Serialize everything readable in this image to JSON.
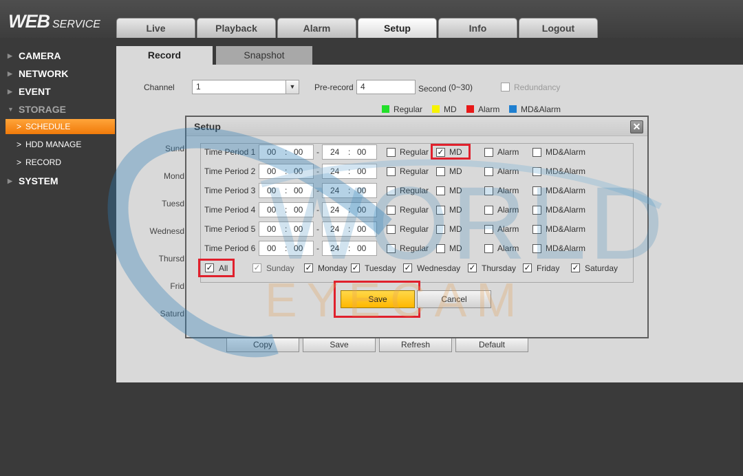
{
  "app": {
    "logo_main": "WEB",
    "logo_sub": "SERVICE"
  },
  "top_tabs": [
    "Live",
    "Playback",
    "Alarm",
    "Setup",
    "Info",
    "Logout"
  ],
  "sidebar": {
    "sections": [
      "CAMERA",
      "NETWORK",
      "EVENT",
      "STORAGE",
      "SYSTEM"
    ],
    "storage_items": [
      "SCHEDULE",
      "HDD MANAGE",
      "RECORD"
    ]
  },
  "sub_tabs": [
    "Record",
    "Snapshot"
  ],
  "record_form": {
    "channel_label": "Channel",
    "channel_value": "1",
    "prerecord_label": "Pre-record",
    "prerecord_value": "4",
    "prerecord_unit": "Second",
    "prerecord_range": "(0~30)",
    "redundancy_label": "Redundancy",
    "legend": [
      {
        "label": "Regular",
        "color": "#22e02a"
      },
      {
        "label": "MD",
        "color": "#f7f300"
      },
      {
        "label": "Alarm",
        "color": "#e81818"
      },
      {
        "label": "MD&Alarm",
        "color": "#1e7fd0"
      }
    ],
    "day_labels": [
      "Sund",
      "Mond",
      "Tuesd",
      "Wednesd",
      "Thursd",
      "Frid",
      "Saturd"
    ],
    "bottom_buttons": [
      "Copy",
      "Save",
      "Refresh",
      "Default"
    ]
  },
  "dialog": {
    "title": "Setup",
    "close_glyph": "✕",
    "periods": [
      {
        "label": "Time Period 1",
        "start_h": "00",
        "start_m": "00",
        "end_h": "24",
        "end_m": "00",
        "regular": false,
        "md": true,
        "alarm": false,
        "md_alarm": false
      },
      {
        "label": "Time Period 2",
        "start_h": "00",
        "start_m": "00",
        "end_h": "24",
        "end_m": "00",
        "regular": false,
        "md": false,
        "alarm": false,
        "md_alarm": false
      },
      {
        "label": "Time Period 3",
        "start_h": "00",
        "start_m": "00",
        "end_h": "24",
        "end_m": "00",
        "regular": false,
        "md": false,
        "alarm": false,
        "md_alarm": false
      },
      {
        "label": "Time Period 4",
        "start_h": "00",
        "start_m": "00",
        "end_h": "24",
        "end_m": "00",
        "regular": false,
        "md": false,
        "alarm": false,
        "md_alarm": false
      },
      {
        "label": "Time Period 5",
        "start_h": "00",
        "start_m": "00",
        "end_h": "24",
        "end_m": "00",
        "regular": false,
        "md": false,
        "alarm": false,
        "md_alarm": false
      },
      {
        "label": "Time Period 6",
        "start_h": "00",
        "start_m": "00",
        "end_h": "24",
        "end_m": "00",
        "regular": false,
        "md": false,
        "alarm": false,
        "md_alarm": false
      }
    ],
    "type_labels": [
      "Regular",
      "MD",
      "Alarm",
      "MD&Alarm"
    ],
    "time_sep": ":",
    "range_sep": "-",
    "all_label": "All",
    "all_checked": true,
    "days": [
      {
        "label": "Sunday",
        "checked": true,
        "disabled": true
      },
      {
        "label": "Monday",
        "checked": true,
        "disabled": false
      },
      {
        "label": "Tuesday",
        "checked": true,
        "disabled": false
      },
      {
        "label": "Wednesday",
        "checked": true,
        "disabled": false
      },
      {
        "label": "Thursday",
        "checked": true,
        "disabled": false
      },
      {
        "label": "Friday",
        "checked": true,
        "disabled": false
      },
      {
        "label": "Saturday",
        "checked": true,
        "disabled": false
      }
    ],
    "save_label": "Save",
    "cancel_label": "Cancel"
  },
  "watermark": {
    "line1": "WORLD",
    "line2": "EYECAM"
  },
  "colors": {
    "highlight_red": "#e0202c",
    "save_button_yellow": "#ffc21a",
    "sidebar_active_orange": "#f58a1f"
  }
}
